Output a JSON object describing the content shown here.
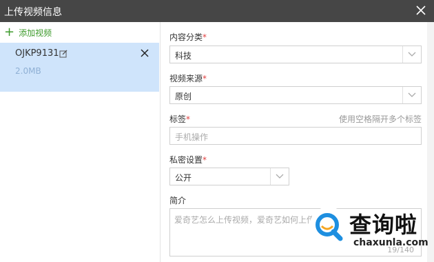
{
  "window": {
    "title": "上传视频信息"
  },
  "sidebar": {
    "add_label": "添加视频",
    "files": [
      {
        "name": "OJKP9131",
        "size": "2.0MB"
      }
    ]
  },
  "form": {
    "category": {
      "label": "内容分类",
      "required": "*",
      "value": "科技"
    },
    "source": {
      "label": "视频来源",
      "required": "*",
      "value": "原创"
    },
    "tags": {
      "label": "标签",
      "required": "*",
      "hint": "使用空格隔开多个标签",
      "placeholder": "手机操作"
    },
    "privacy": {
      "label": "私密设置",
      "required": "*",
      "value": "公开"
    },
    "intro": {
      "label": "简介",
      "text": "爱奇艺怎么上传视频，爱奇艺如何上传",
      "counter": "19/140"
    }
  },
  "watermark": {
    "brand": "查询啦",
    "domain": "chaxunla.com"
  },
  "colors": {
    "titlebar": "#464646",
    "selected_row": "#cfe4fb",
    "add_green": "#3d9a2b",
    "required_red": "#e04040",
    "watermark_blue": "#1e8fe0"
  }
}
